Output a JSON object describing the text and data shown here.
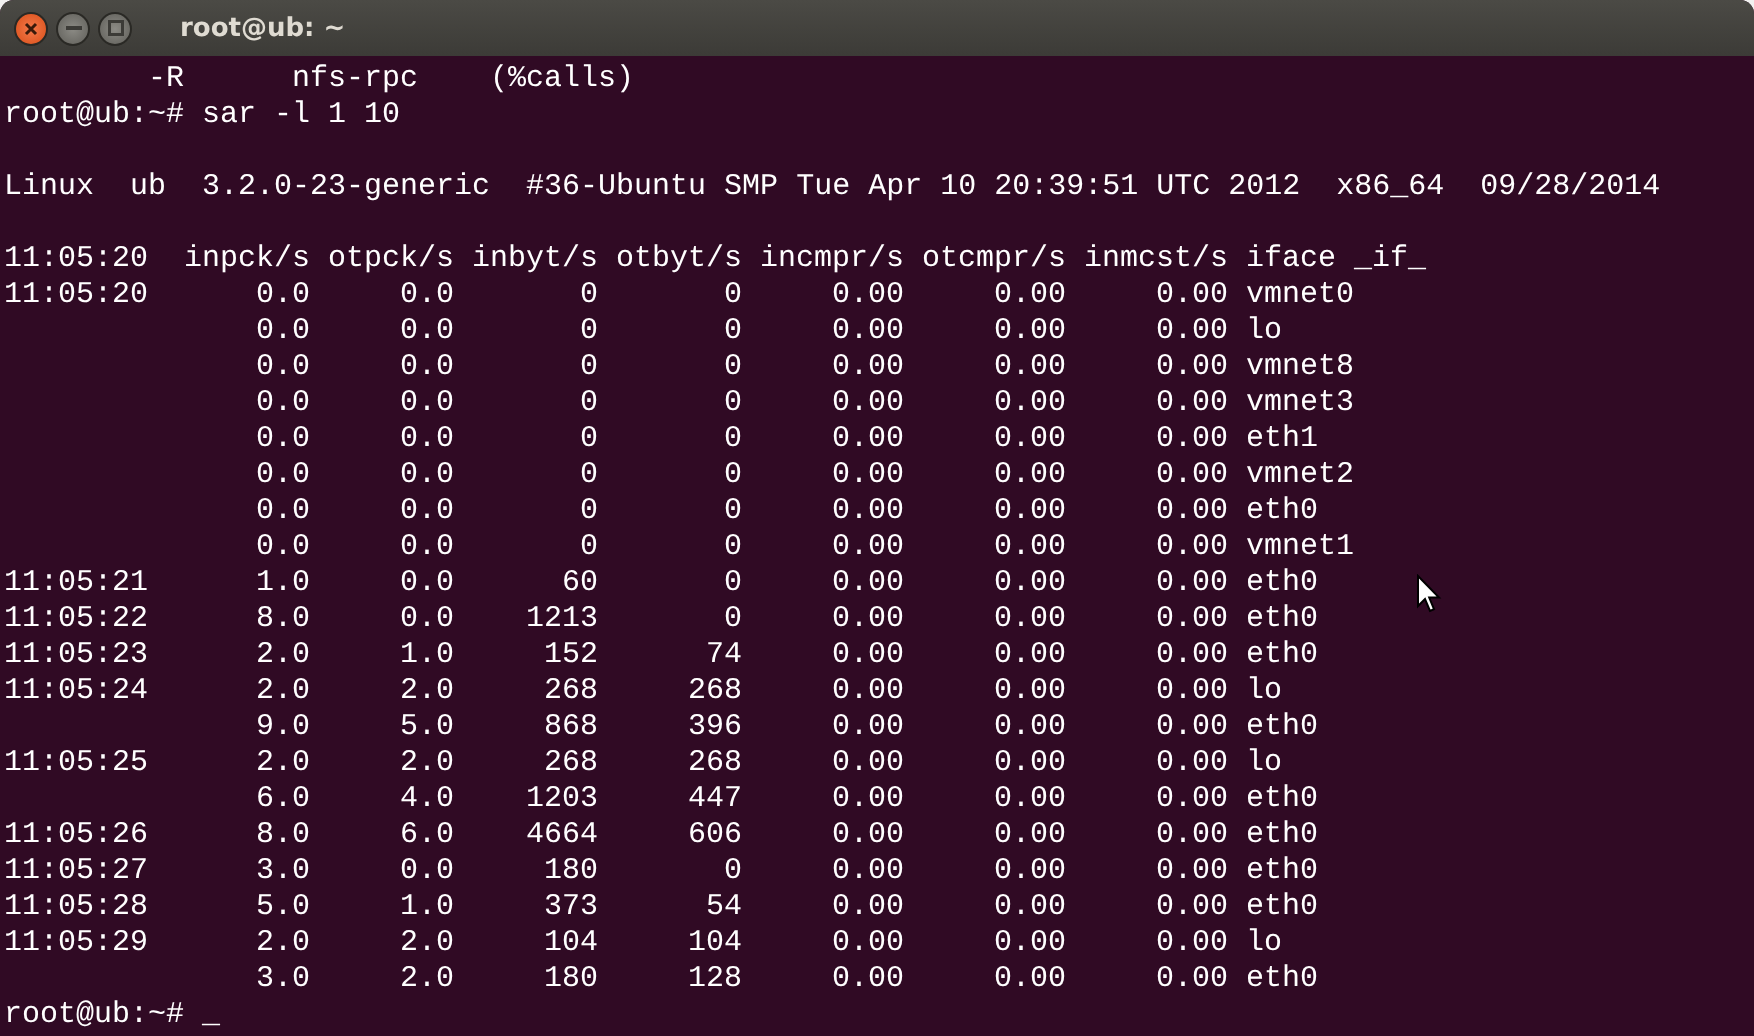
{
  "window": {
    "title": "root@ub: ~"
  },
  "lines_before": [
    {
      "kind": "text",
      "text": "        -R      nfs-rpc    (%calls)"
    },
    {
      "kind": "text",
      "text": "root@ub:~# sar -l 1 10"
    },
    {
      "kind": "blank"
    },
    {
      "kind": "text",
      "text": "Linux  ub  3.2.0-23-generic  #36-Ubuntu SMP Tue Apr 10 20:39:51 UTC 2012  x86_64  09/28/2014"
    },
    {
      "kind": "blank"
    }
  ],
  "table": {
    "columns": [
      "11:05:20",
      "inpck/s",
      "otpck/s",
      "inbyt/s",
      "otbyt/s",
      "incmpr/s",
      "otcmpr/s",
      "inmcst/s",
      "iface _if_"
    ],
    "rows": [
      [
        "11:05:20",
        "0.0",
        "0.0",
        "0",
        "0",
        "0.00",
        "0.00",
        "0.00",
        "vmnet0"
      ],
      [
        "",
        "0.0",
        "0.0",
        "0",
        "0",
        "0.00",
        "0.00",
        "0.00",
        "lo"
      ],
      [
        "",
        "0.0",
        "0.0",
        "0",
        "0",
        "0.00",
        "0.00",
        "0.00",
        "vmnet8"
      ],
      [
        "",
        "0.0",
        "0.0",
        "0",
        "0",
        "0.00",
        "0.00",
        "0.00",
        "vmnet3"
      ],
      [
        "",
        "0.0",
        "0.0",
        "0",
        "0",
        "0.00",
        "0.00",
        "0.00",
        "eth1"
      ],
      [
        "",
        "0.0",
        "0.0",
        "0",
        "0",
        "0.00",
        "0.00",
        "0.00",
        "vmnet2"
      ],
      [
        "",
        "0.0",
        "0.0",
        "0",
        "0",
        "0.00",
        "0.00",
        "0.00",
        "eth0"
      ],
      [
        "",
        "0.0",
        "0.0",
        "0",
        "0",
        "0.00",
        "0.00",
        "0.00",
        "vmnet1"
      ],
      [
        "11:05:21",
        "1.0",
        "0.0",
        "60",
        "0",
        "0.00",
        "0.00",
        "0.00",
        "eth0"
      ],
      [
        "11:05:22",
        "8.0",
        "0.0",
        "1213",
        "0",
        "0.00",
        "0.00",
        "0.00",
        "eth0"
      ],
      [
        "11:05:23",
        "2.0",
        "1.0",
        "152",
        "74",
        "0.00",
        "0.00",
        "0.00",
        "eth0"
      ],
      [
        "11:05:24",
        "2.0",
        "2.0",
        "268",
        "268",
        "0.00",
        "0.00",
        "0.00",
        "lo"
      ],
      [
        "",
        "9.0",
        "5.0",
        "868",
        "396",
        "0.00",
        "0.00",
        "0.00",
        "eth0"
      ],
      [
        "11:05:25",
        "2.0",
        "2.0",
        "268",
        "268",
        "0.00",
        "0.00",
        "0.00",
        "lo"
      ],
      [
        "",
        "6.0",
        "4.0",
        "1203",
        "447",
        "0.00",
        "0.00",
        "0.00",
        "eth0"
      ],
      [
        "11:05:26",
        "8.0",
        "6.0",
        "4664",
        "606",
        "0.00",
        "0.00",
        "0.00",
        "eth0"
      ],
      [
        "11:05:27",
        "3.0",
        "0.0",
        "180",
        "0",
        "0.00",
        "0.00",
        "0.00",
        "eth0"
      ],
      [
        "11:05:28",
        "5.0",
        "1.0",
        "373",
        "54",
        "0.00",
        "0.00",
        "0.00",
        "eth0"
      ],
      [
        "11:05:29",
        "2.0",
        "2.0",
        "104",
        "104",
        "0.00",
        "0.00",
        "0.00",
        "lo"
      ],
      [
        "",
        "3.0",
        "2.0",
        "180",
        "128",
        "0.00",
        "0.00",
        "0.00",
        "eth0"
      ]
    ]
  },
  "prompt": {
    "text": "root@ub:~# ",
    "cursor": "_"
  }
}
